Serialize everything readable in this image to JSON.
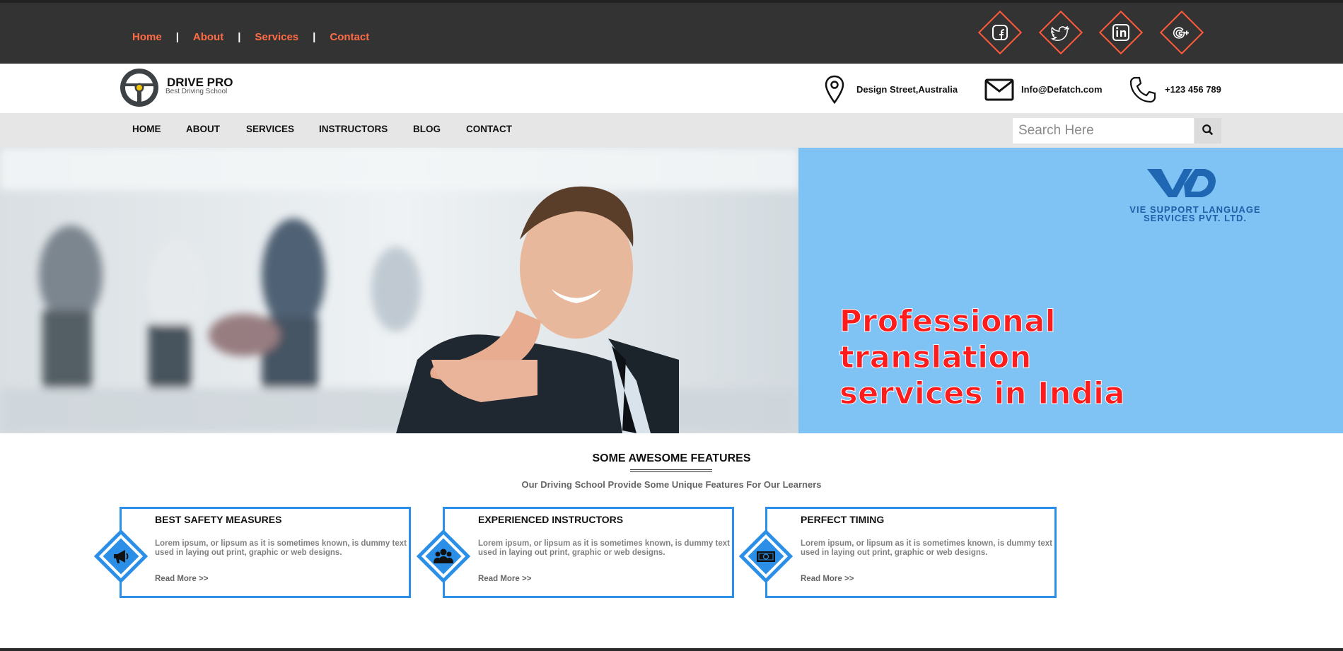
{
  "topbar": {
    "links": [
      "Home",
      "About",
      "Services",
      "Contact"
    ],
    "separator": "|",
    "social": [
      "facebook-icon",
      "twitter-icon",
      "linkedin-icon",
      "google-plus-icon"
    ]
  },
  "header": {
    "brand": "DRIVE PRO",
    "tagline": "Best Driving School",
    "address": "Design Street,Australia",
    "email": "Info@Defatch.com",
    "phone": "+123 456 789"
  },
  "nav": {
    "items": [
      "HOME",
      "ABOUT",
      "SERVICES",
      "INSTRUCTORS",
      "BLOG",
      "CONTACT"
    ],
    "search_placeholder": "Search Here"
  },
  "hero": {
    "company_line1": "VIE SUPPORT LANGUAGE",
    "company_line2": "SERVICES PVT. LTD.",
    "headline_line1": "Professional",
    "headline_line2": "translation",
    "headline_line3": "services in India"
  },
  "features": {
    "title": "SOME AWESOME FEATURES",
    "subtitle": "Our Driving School Provide Some Unique Features For Our Learners",
    "cards": [
      {
        "title": "BEST SAFETY MEASURES",
        "desc": "Lorem ipsum, or lipsum as it is sometimes known, is dummy text used in laying out print, graphic or web designs.",
        "more": "Read More >>",
        "icon": "megaphone-icon"
      },
      {
        "title": "EXPERIENCED INSTRUCTORS",
        "desc": "Lorem ipsum, or lipsum as it is sometimes known, is dummy text used in laying out print, graphic or web designs.",
        "more": "Read More >>",
        "icon": "users-icon"
      },
      {
        "title": "PERFECT TIMING",
        "desc": "Lorem ipsum, or lipsum as it is sometimes known, is dummy text used in laying out print, graphic or web designs.",
        "more": "Read More >>",
        "icon": "money-icon"
      }
    ]
  },
  "colors": {
    "accent": "#ff6b45",
    "feature_blue": "#2b8fe8",
    "topbar": "#333333",
    "navbar": "#e6e6e6",
    "hero_blue": "#7fc2f4"
  }
}
